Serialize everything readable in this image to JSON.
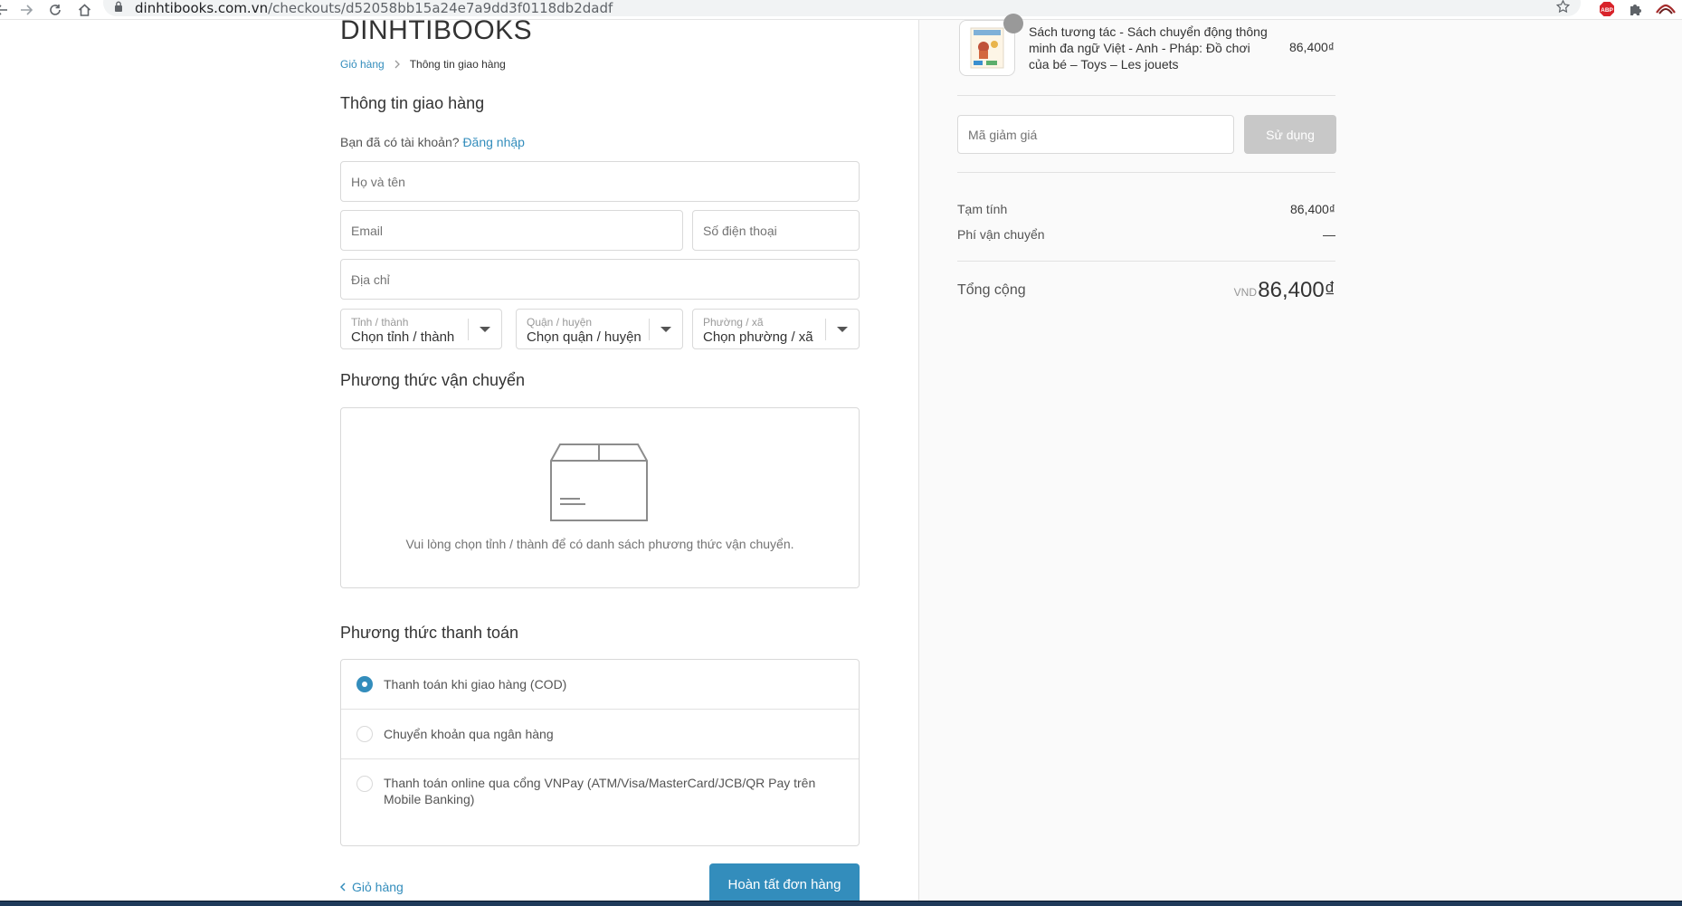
{
  "browser": {
    "url_domain": "dinhtibooks.com.vn",
    "url_path": "/checkouts/d52058bb15a24e7a9dd3f0118db2dadf",
    "adblock_badge": "ABP"
  },
  "shop": {
    "logo": "DINHTIBOOKS"
  },
  "breadcrumb": {
    "cart": "Giỏ hàng",
    "current": "Thông tin giao hàng"
  },
  "shipping_info": {
    "title": "Thông tin giao hàng",
    "have_account": "Bạn đã có tài khoản?",
    "login_link": "Đăng nhập",
    "fullname_placeholder": "Họ và tên",
    "email_placeholder": "Email",
    "phone_placeholder": "Số điện thoại",
    "address_placeholder": "Địa chỉ",
    "province": {
      "label": "Tỉnh / thành",
      "value": "Chọn tỉnh / thành"
    },
    "district": {
      "label": "Quận / huyện",
      "value": "Chọn quận / huyện"
    },
    "ward": {
      "label": "Phường / xã",
      "value": "Chọn phường / xã"
    }
  },
  "shipping_method": {
    "title": "Phương thức vận chuyển",
    "message": "Vui lòng chọn tỉnh / thành để có danh sách phương thức vận chuyển."
  },
  "payment": {
    "title": "Phương thức thanh toán",
    "options": [
      {
        "label": "Thanh toán khi giao hàng (COD)",
        "selected": true
      },
      {
        "label": "Chuyển khoản qua ngân hàng",
        "selected": false
      },
      {
        "label": "Thanh toán online qua cổng VNPay (ATM/Visa/MasterCard/JCB/QR Pay trên Mobile Banking)",
        "selected": false
      }
    ]
  },
  "footer": {
    "back_link": "Giỏ hàng",
    "complete_button": "Hoàn tất đơn hàng"
  },
  "order": {
    "product": {
      "name": "Sách tương tác - Sách chuyển động thông minh đa ngữ Việt - Anh - Pháp: Đồ chơi của bé – Toys – Les jouets",
      "price": "86,400₫"
    },
    "discount_placeholder": "Mã giảm giá",
    "apply_button": "Sử dụng",
    "subtotal_label": "Tạm tính",
    "subtotal_value": "86,400₫",
    "shipping_label": "Phí vận chuyển",
    "shipping_value": "—",
    "total_label": "Tổng cộng",
    "currency": "VND",
    "total_value": "86,400₫"
  },
  "colors": {
    "accent": "#338dbc",
    "disabled_button": "#c8c8c8",
    "summary_bg": "#fafafa"
  }
}
